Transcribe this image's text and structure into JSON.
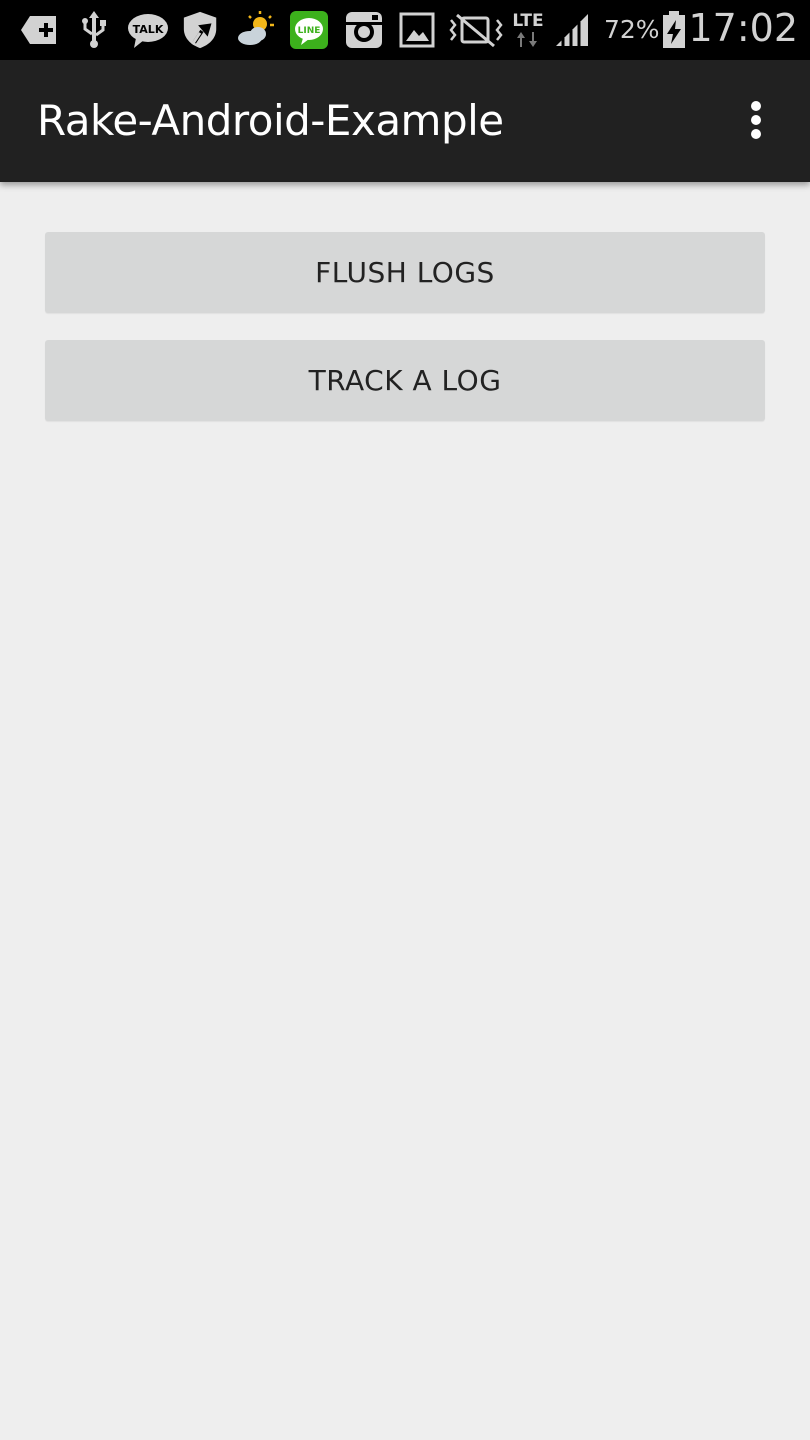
{
  "status_bar": {
    "time": "17:02",
    "battery_percent": "72%",
    "network": "LTE",
    "icons": [
      "notification-plus-icon",
      "usb-icon",
      "kakaotalk-icon",
      "shield-update-icon",
      "weather-icon",
      "line-icon",
      "instagram-icon",
      "gallery-icon",
      "mute-vibrate-icon",
      "lte-icon",
      "signal-icon",
      "battery-charging-icon"
    ],
    "kakao_label": "TALK",
    "line_label": "LINE"
  },
  "action_bar": {
    "title": "Rake-Android-Example"
  },
  "buttons": {
    "flush_label": "FLUSH LOGS",
    "track_label": "TRACK A LOG"
  },
  "colors": {
    "status_bar_bg": "#000000",
    "action_bar_bg": "#212121",
    "page_bg": "#eeeeee",
    "button_bg": "#d6d7d7",
    "line_green": "#3cb11c",
    "weather_sun": "#f2b619"
  }
}
